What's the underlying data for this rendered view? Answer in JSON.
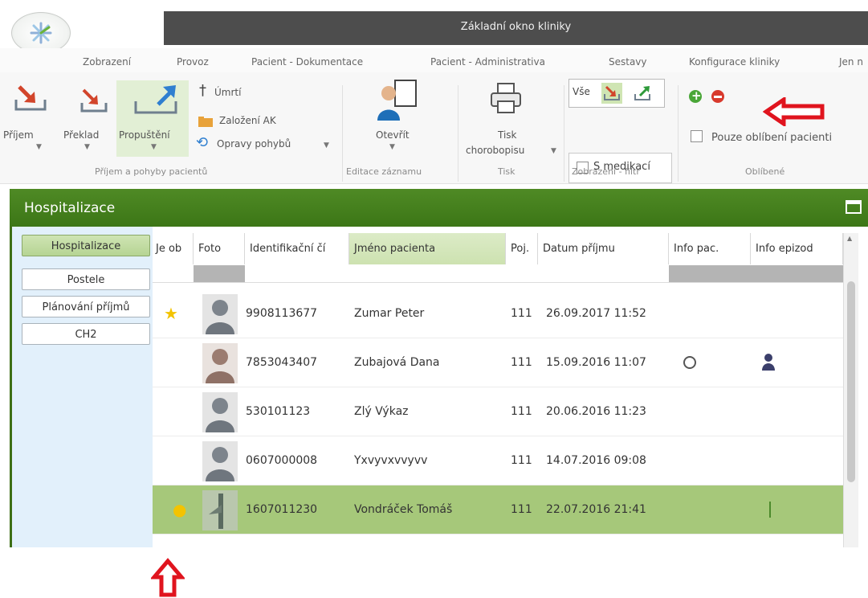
{
  "window_title": "Základní okno kliniky",
  "ribbon_tabs": [
    "Zobrazení",
    "Provoz",
    "Pacient - Dokumentace",
    "Pacient - Administrativa",
    "Sestavy",
    "Konfigurace kliniky",
    "Jen n"
  ],
  "ribbon": {
    "prijem": "Příjem",
    "preklad": "Překlad",
    "propusteni": "Propuštění",
    "umrti": "Úmrtí",
    "zalozeni_ak": "Založení AK",
    "opravy_pohybu": "Opravy pohybů",
    "group_pohyby": "Příjem a pohyby pacientů",
    "otevrit": "Otevřít",
    "group_editace": "Editace záznamu",
    "tisk_line1": "Tisk",
    "tisk_line2": "chorobopisu",
    "group_tisk": "Tisk",
    "vse": "Vše",
    "s_medikaci": "S medikací",
    "group_zobrazeni": "Zobrazení - filtr",
    "pouze_oblibeni": "Pouze oblíbení pacienti",
    "group_oblibene": "Oblíbené"
  },
  "panel_title": "Hospitalizace",
  "left_tabs": [
    "Hospitalizace",
    "Postele",
    "Plánování příjmů",
    "CH2"
  ],
  "grid": {
    "columns": [
      "Je ob",
      "Foto",
      "Identifikační čí",
      "Jméno pacienta",
      "Poj.",
      "Datum příjmu",
      "Info pac.",
      "Info epizod"
    ],
    "rows": [
      {
        "id": "9908113677",
        "name": "Zumar Peter",
        "poj": "111",
        "date": "26.09.2017 11:52",
        "favorite": true
      },
      {
        "id": "7853043407",
        "name": "Zubajová Dana",
        "poj": "111",
        "date": "15.09.2016 11:07",
        "favorite": false
      },
      {
        "id": "530101123",
        "name": "Zlý Výkaz",
        "poj": "111",
        "date": "20.06.2016 11:23",
        "favorite": false
      },
      {
        "id": "0607000008",
        "name": "Yxvyvxvvyvv",
        "poj": "111",
        "date": "14.07.2016 09:08",
        "favorite": false
      },
      {
        "id": "1607011230",
        "name": "Vondráček Tomáš",
        "poj": "111",
        "date": "22.07.2016 21:41",
        "favorite": true
      }
    ]
  },
  "colors": {
    "accent_green": "#4f8a25",
    "selected_row": "#a6c87a",
    "annotation_red": "#e0141e",
    "star": "#f3c300"
  },
  "icons": [
    "app-logo-icon",
    "admission-icon",
    "transfer-icon",
    "discharge-icon",
    "cross-icon",
    "folder-icon",
    "undo-icon",
    "doctor-document-icon",
    "printer-icon",
    "add-favorite-icon",
    "remove-favorite-icon",
    "star-icon",
    "person-icon",
    "circle-icon",
    "maximize-icon"
  ]
}
